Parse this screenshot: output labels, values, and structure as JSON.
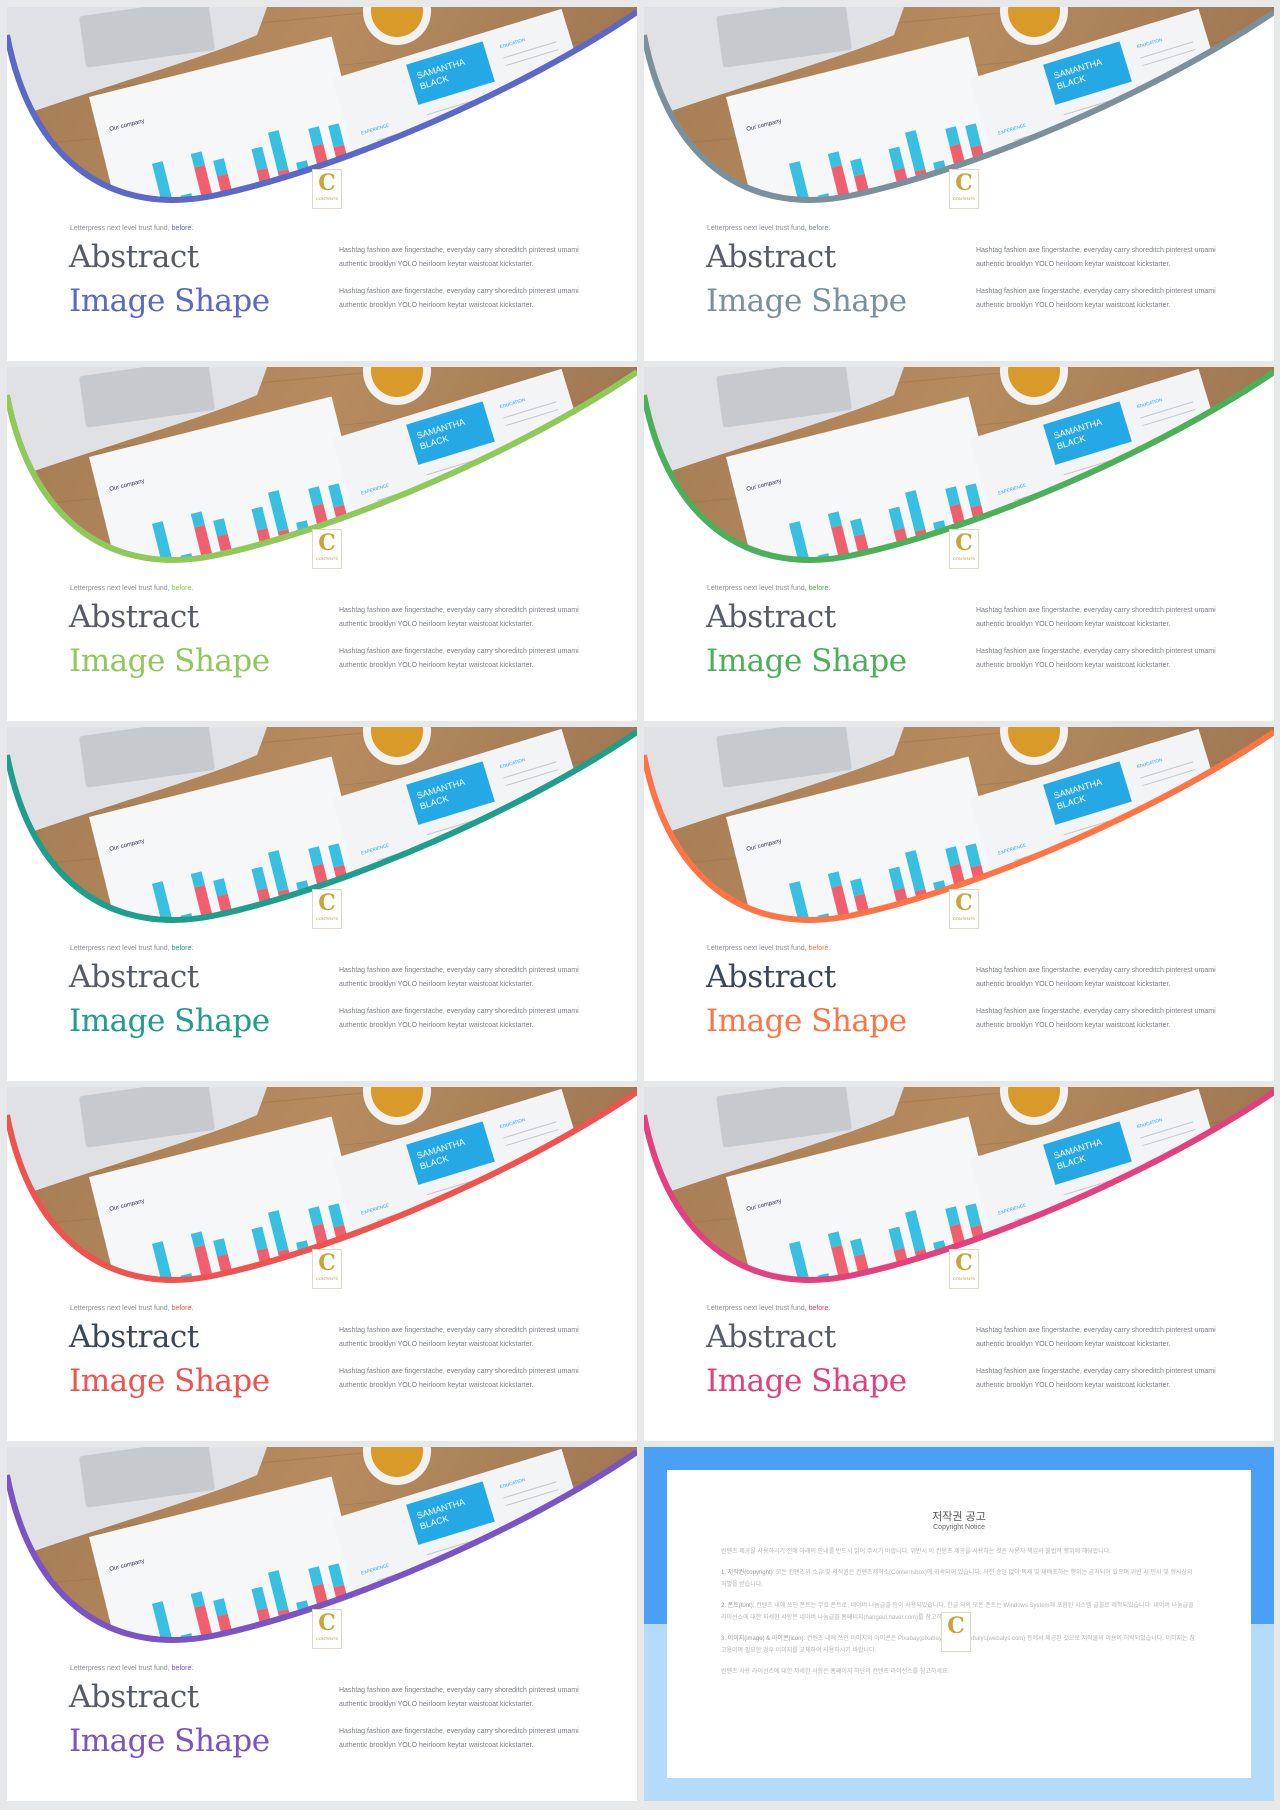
{
  "slide_common": {
    "kicker": "Letterpress next level trust fund,",
    "kicker_accent": "before.",
    "title_line1": "Abstract",
    "title_line2": "Image Shape",
    "paragraph1": "Hashtag fashion axe fingerstache, everyday carry shoreditch pinterest umami authentic brooklyn YOLO heirloom keytar waistcoat kickstarter.",
    "paragraph2": "Hashtag fashion axe fingerstache, everyday carry shoreditch pinterest umami authentic brooklyn YOLO heirloom keytar waistcoat kickstarter.",
    "photo_text": {
      "chart_title": "Our company",
      "resume_name": "SAMANTHA BLACK",
      "experience": "EXPERIENCE",
      "education": "EDUCATION"
    },
    "logo_text": "CONTENTS"
  },
  "slides": [
    {
      "accent": "#5b68c6",
      "title_color": "#565b66"
    },
    {
      "accent": "#7b909b",
      "title_color": "#565b66"
    },
    {
      "accent": "#8fc95a",
      "title_color": "#565b66"
    },
    {
      "accent": "#4cb05a",
      "title_color": "#565b66"
    },
    {
      "accent": "#1f9e8c",
      "title_color": "#565b66"
    },
    {
      "accent": "#ff7445",
      "title_color": "#3b4758"
    },
    {
      "accent": "#ef5350",
      "title_color": "#3b4758"
    },
    {
      "accent": "#e2407e",
      "title_color": "#565b66"
    },
    {
      "accent": "#7b54c4",
      "title_color": "#565b66"
    }
  ],
  "notice": {
    "title": "저작권 공고",
    "subtitle": "Copyright Notice",
    "intro": "컨텐츠 제공을 사용하시기 전에 아래의 안내를 반드시 읽어 주시기 바랍니다. 위반시 이 컨텐츠 제공을 사용하는 것은 사용자 책임의 불법적 행위에 해당합니다.",
    "item1_label": "1. 저작권(copyright):",
    "item1": "모든 컨텐츠의 소유 및 저작권은 컨텐츠제작소(Contentsbox)에 귀속되어 있습니다. 사전 승인 없이 복제 및 재배포하는 행위는 금지되어 있으며 위반 시 민사 및 형사상의 처벌을 받습니다.",
    "item2_label": "2. 폰트(font):",
    "item2": "컨텐츠 내에 쓰인 폰트는 무료 폰트로, 네이버 나눔글꼴 등이 사용되었습니다. 한글 외의 모든 폰트는 Windows System에 포함된 시스템 글꼴로 제작되었습니다. 네이버 나눔글꼴 라이선스에 대한 자세한 사항은 네이버 나눔글꼴 홈페이지(hangeul.naver.com)를 참고하세요.",
    "item3_label": "3. 이미지(image) & 아이콘(icon):",
    "item3": "컨텐츠 내에 쓰인 이미지와 아이콘은 Pixabay(pixabay.com)와 Webalys(webalys.com) 등에서 제공된 것으로 저작물의 이용이 허락되었습니다. 이미지는 참고용이며 필요한 경우 이미지를 교체하여 사용하시기 바랍니다.",
    "outro": "컨텐츠 사용 라이선스에 대한 자세한 사항은 홈페이지 하단의 컨텐츠 라이선스를 참고하세요."
  }
}
